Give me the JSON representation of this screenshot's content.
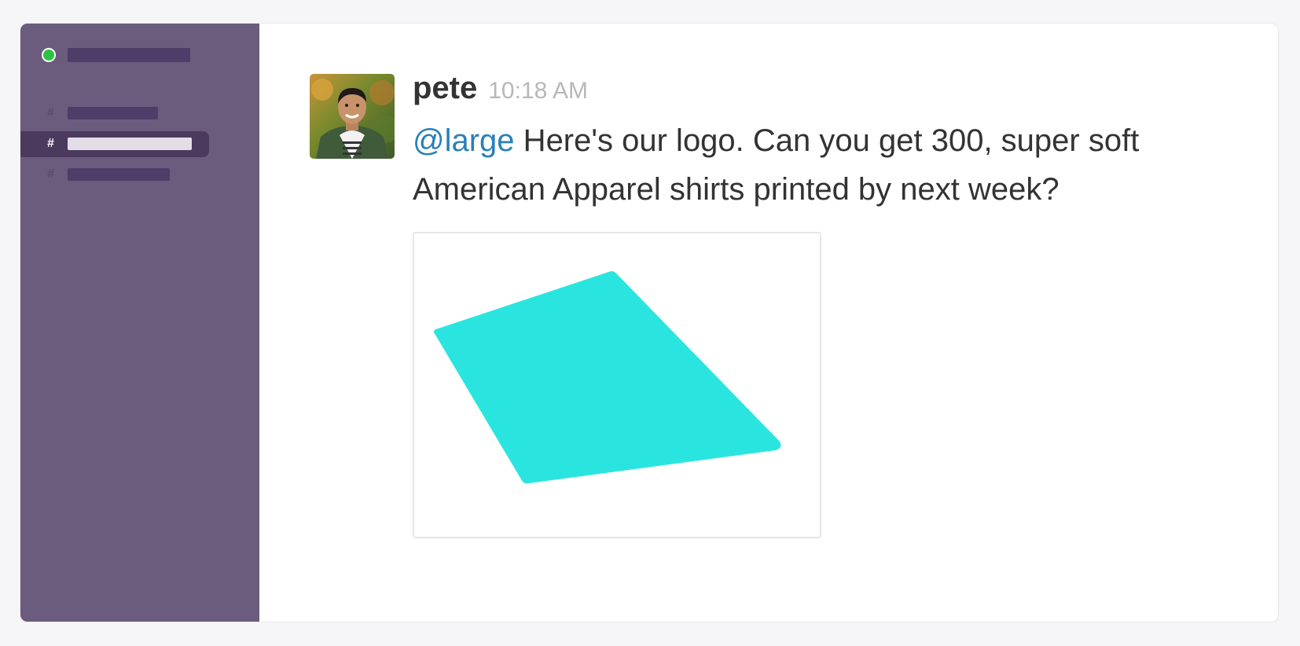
{
  "sidebar": {
    "presence_color": "#2bc340",
    "channels": [
      {
        "symbol": "#",
        "active": false
      },
      {
        "symbol": "#",
        "active": true
      },
      {
        "symbol": "#",
        "active": false
      }
    ]
  },
  "message": {
    "author": "pete",
    "timestamp": "10:18 AM",
    "mention": "@large",
    "text": " Here's our logo. Can you get 300, super soft American Apparel shirts printed by next week?",
    "avatar_icon": "user-photo-avatar",
    "attachment": {
      "icon": "logo-image",
      "logo_color": "#2ae5df"
    }
  },
  "colors": {
    "sidebar_bg": "#6b5b7d",
    "mention": "#2a80b9",
    "logo": "#2ae5df"
  }
}
